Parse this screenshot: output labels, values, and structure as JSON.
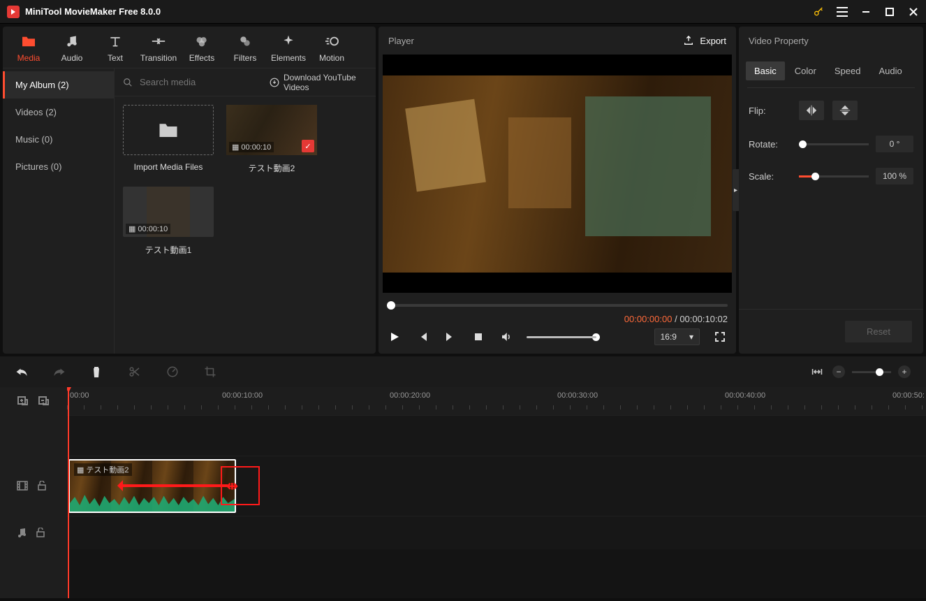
{
  "app": {
    "title": "MiniTool MovieMaker Free 8.0.0"
  },
  "tool_tabs": [
    {
      "id": "media",
      "label": "Media"
    },
    {
      "id": "audio",
      "label": "Audio"
    },
    {
      "id": "text",
      "label": "Text"
    },
    {
      "id": "transition",
      "label": "Transition"
    },
    {
      "id": "effects",
      "label": "Effects"
    },
    {
      "id": "filters",
      "label": "Filters"
    },
    {
      "id": "elements",
      "label": "Elements"
    },
    {
      "id": "motion",
      "label": "Motion"
    }
  ],
  "library_sidebar": [
    {
      "label": "My Album (2)",
      "active": true
    },
    {
      "label": "Videos (2)"
    },
    {
      "label": "Music (0)"
    },
    {
      "label": "Pictures (0)"
    }
  ],
  "library": {
    "search_placeholder": "Search media",
    "download_link": "Download YouTube Videos",
    "import_label": "Import Media Files",
    "clips": [
      {
        "name": "テスト動画2",
        "duration": "00:00:10",
        "checked": true,
        "landscape": true
      },
      {
        "name": "テスト動画1",
        "duration": "00:00:10",
        "checked": false,
        "landscape": false
      }
    ]
  },
  "player": {
    "title": "Player",
    "export_label": "Export",
    "current_time": "00:00:00:00",
    "total_time": "00:00:10:02",
    "aspect": "16:9"
  },
  "property": {
    "title": "Video Property",
    "tabs": [
      "Basic",
      "Color",
      "Speed",
      "Audio"
    ],
    "flip_label": "Flip:",
    "rotate_label": "Rotate:",
    "rotate_value": "0 °",
    "scale_label": "Scale:",
    "scale_value": "100 %",
    "reset_label": "Reset"
  },
  "timeline": {
    "ruler": [
      "00:00",
      "00:00:10:00",
      "00:00:20:00",
      "00:00:30:00",
      "00:00:40:00",
      "00:00:50:"
    ],
    "clip_name": "テスト動画2"
  }
}
